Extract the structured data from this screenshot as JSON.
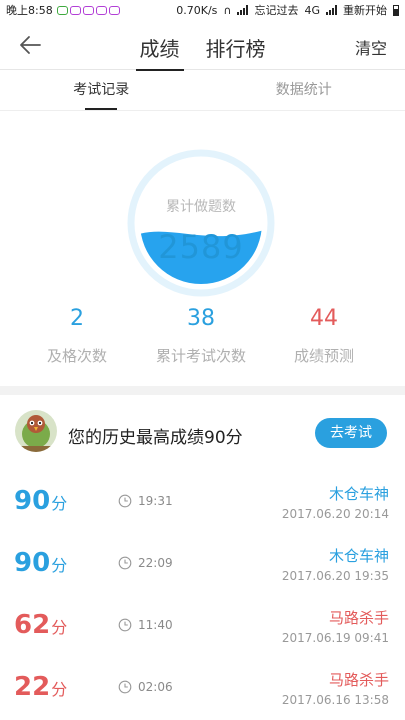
{
  "status_bar": {
    "time": "晚上8:58",
    "net_speed": "0.70K/s",
    "carrier": "忘记过去",
    "network": "4G",
    "carrier2": "重新开始"
  },
  "nav": {
    "back_icon": "arrow-left-icon",
    "tabs": [
      {
        "label": "成绩",
        "active": true
      },
      {
        "label": "排行榜",
        "active": false
      }
    ],
    "clear_label": "清空"
  },
  "sub_tabs": [
    {
      "label": "考试记录",
      "active": true
    },
    {
      "label": "数据统计",
      "active": false
    }
  ],
  "summary": {
    "gauge_label": "累计做题数",
    "gauge_value": "2589",
    "gauge_fill_fraction": 0.4,
    "stats": [
      {
        "value": "2",
        "label": "及格次数",
        "color": "#2aa0df"
      },
      {
        "value": "38",
        "label": "累计考试次数",
        "color": "#2aa0df"
      },
      {
        "value": "44",
        "label": "成绩预测",
        "color": "#e35b5b"
      }
    ]
  },
  "best": {
    "text": "您的历史最高成绩90分",
    "button_label": "去考试"
  },
  "records": [
    {
      "score": "90",
      "unit": "分",
      "duration": "19:31",
      "title": "木仓车神",
      "date": "2017.06.20  20:14",
      "color": "blue"
    },
    {
      "score": "90",
      "unit": "分",
      "duration": "22:09",
      "title": "木仓车神",
      "date": "2017.06.20  19:35",
      "color": "blue"
    },
    {
      "score": "62",
      "unit": "分",
      "duration": "11:40",
      "title": "马路杀手",
      "date": "2017.06.19  09:41",
      "color": "red"
    },
    {
      "score": "22",
      "unit": "分",
      "duration": "02:06",
      "title": "马路杀手",
      "date": "2017.06.16  13:58",
      "color": "red"
    }
  ],
  "colors": {
    "accent_blue": "#2aa0df",
    "accent_red": "#e35b5b"
  }
}
